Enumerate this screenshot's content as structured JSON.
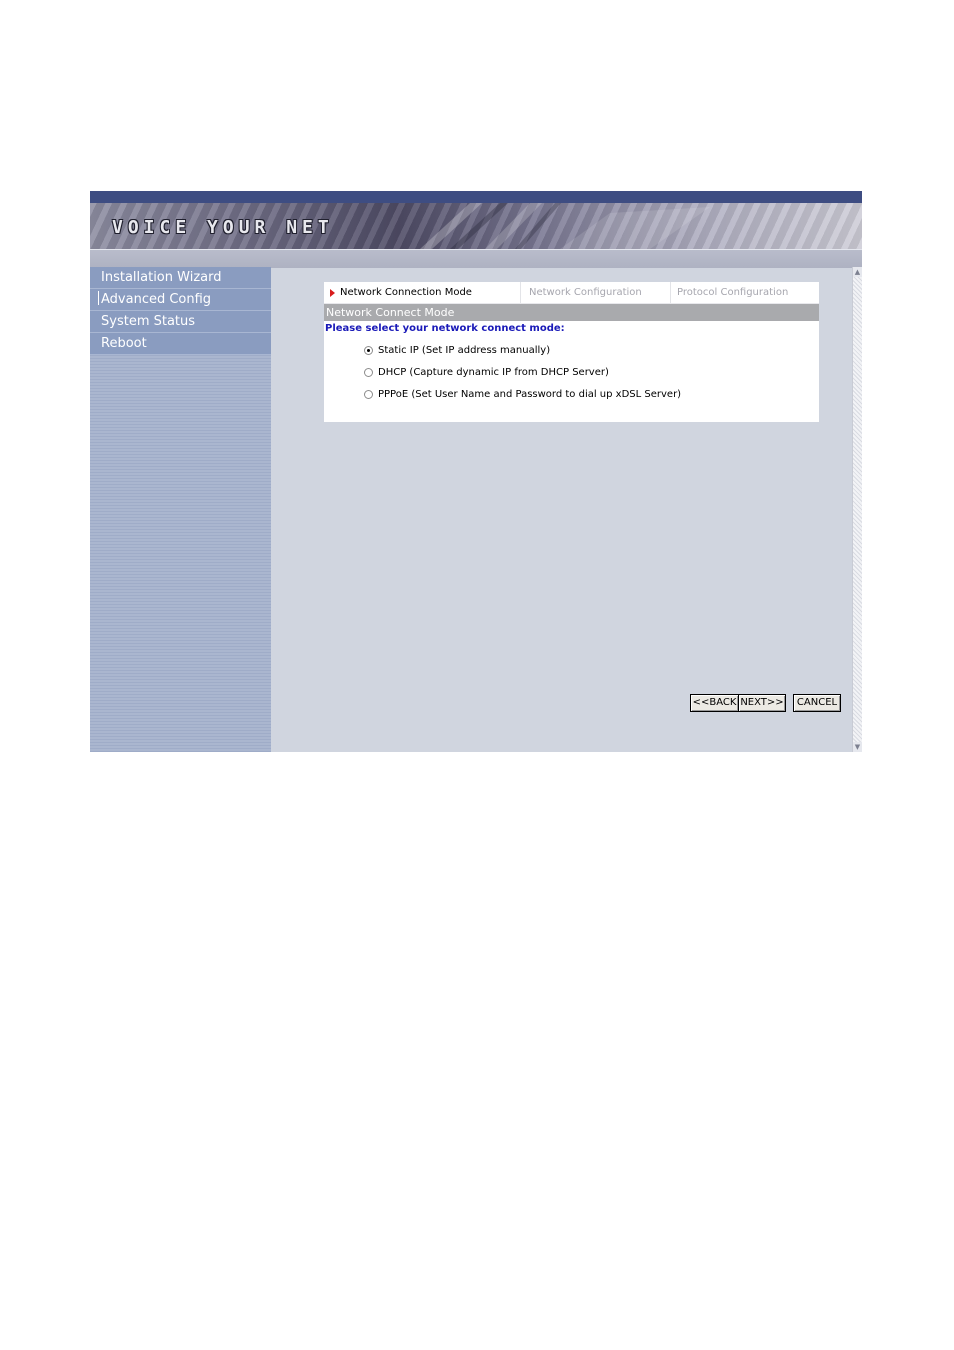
{
  "banner": {
    "logo_text": "VOICE YOUR NET"
  },
  "sidebar": {
    "items": [
      {
        "label": "Installation Wizard"
      },
      {
        "label": "Advanced Config"
      },
      {
        "label": "System Status"
      },
      {
        "label": "Reboot"
      }
    ]
  },
  "wizard": {
    "steps": [
      {
        "label": "Network Connection Mode",
        "active": true
      },
      {
        "label": "Network Configuration",
        "active": false
      },
      {
        "label": "Protocol Configuration",
        "active": false
      }
    ],
    "section_title": "Network Connect Mode",
    "prompt": "Please select your network connect mode:",
    "options": [
      {
        "label": "Static IP (Set IP address manually)",
        "selected": true
      },
      {
        "label": "DHCP (Capture dynamic IP from DHCP Server)",
        "selected": false
      },
      {
        "label": "PPPoE (Set User Name and Password to dial up xDSL Server)",
        "selected": false
      }
    ]
  },
  "buttons": {
    "back": "<<BACK",
    "next": "NEXT>>",
    "cancel": "CANCEL"
  },
  "colors": {
    "sidebar_item_bg": "#8a9cc0",
    "content_bg": "#d0d5df",
    "active_step_marker": "#d81d1d",
    "prompt_text": "#1a1ab8"
  }
}
